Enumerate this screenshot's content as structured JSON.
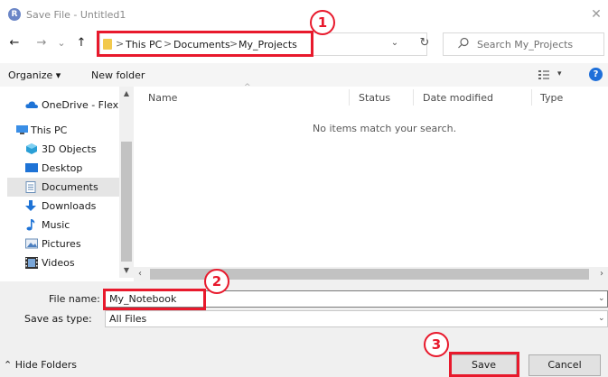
{
  "window": {
    "title": "Save File - Untitled1",
    "app_icon_letter": "R",
    "close_glyph": "✕"
  },
  "nav": {
    "back_glyph": "←",
    "forward_glyph": "→",
    "recent_glyph": "⌄",
    "up_glyph": "↑",
    "refresh_glyph": "↻",
    "dropdown_glyph": "⌄"
  },
  "address": {
    "separator": ">",
    "crumbs": [
      "This PC",
      "Documents",
      "My_Projects"
    ]
  },
  "search": {
    "placeholder": "Search My_Projects"
  },
  "toolbar": {
    "organize_label": "Organize ▾",
    "new_folder_label": "New folder",
    "view_caret": "▾",
    "help_label": "?"
  },
  "sidebar": {
    "items": [
      {
        "label": "OneDrive - Flexible",
        "icon": "cloud-icon"
      },
      {
        "label": "This PC",
        "icon": "computer-icon"
      },
      {
        "label": "3D Objects",
        "icon": "cube-icon"
      },
      {
        "label": "Desktop",
        "icon": "desktop-icon"
      },
      {
        "label": "Documents",
        "icon": "document-icon"
      },
      {
        "label": "Downloads",
        "icon": "download-icon"
      },
      {
        "label": "Music",
        "icon": "music-icon"
      },
      {
        "label": "Pictures",
        "icon": "picture-icon"
      },
      {
        "label": "Videos",
        "icon": "video-icon"
      }
    ],
    "selected_index": 4
  },
  "file_list": {
    "columns": [
      "Name",
      "Status",
      "Date modified",
      "Type"
    ],
    "empty_message": "No items match your search."
  },
  "form": {
    "file_name_label": "File name:",
    "file_name_value": "My_Notebook",
    "save_as_type_label": "Save as type:",
    "save_as_type_value": "All Files"
  },
  "buttons": {
    "save_label": "Save",
    "cancel_label": "Cancel",
    "hide_folders_label": "Hide Folders"
  },
  "callouts": [
    {
      "number": "1"
    },
    {
      "number": "2"
    },
    {
      "number": "3"
    }
  ],
  "colors": {
    "callout": "#e8192c",
    "help": "#1e6fd9",
    "folder": "#f2c94c"
  }
}
